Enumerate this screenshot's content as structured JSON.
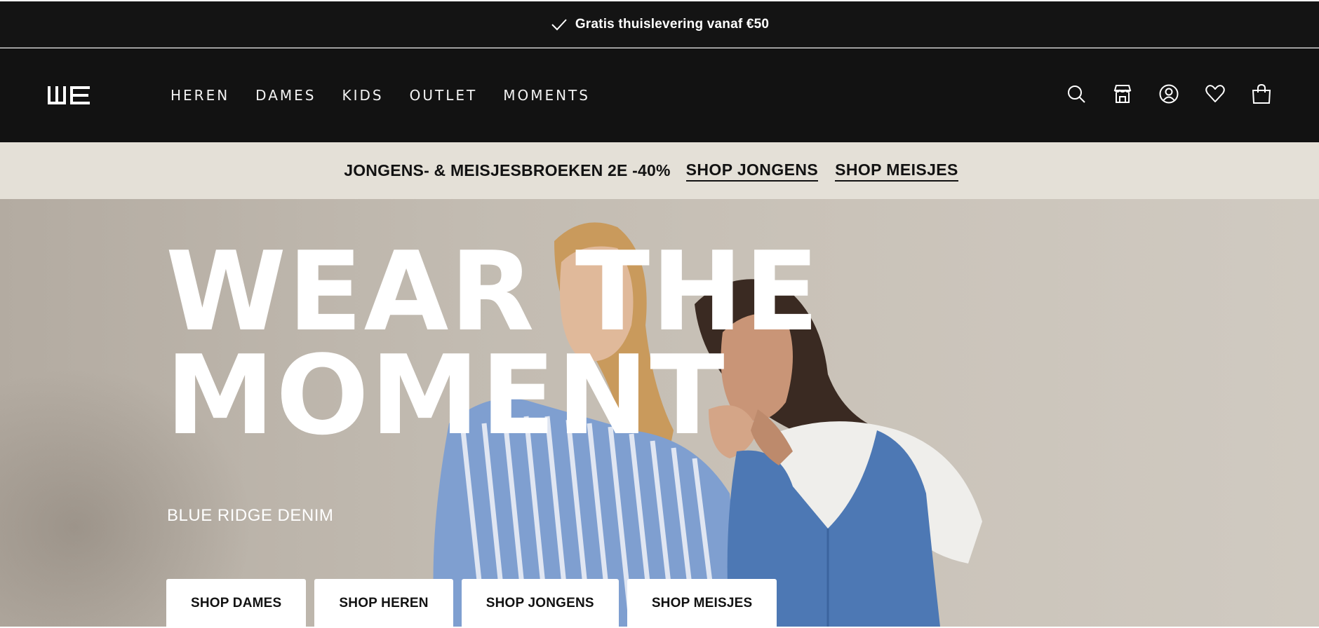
{
  "topbar": {
    "notice": "Gratis thuislevering vanaf €50",
    "icon": "checkmark-icon"
  },
  "header": {
    "logo_text": "WE",
    "nav": [
      {
        "label": "HEREN"
      },
      {
        "label": "DAMES"
      },
      {
        "label": "KIDS"
      },
      {
        "label": "OUTLET"
      },
      {
        "label": "MOMENTS"
      }
    ],
    "icons": [
      "search-icon",
      "store-icon",
      "account-icon",
      "wishlist-icon",
      "bag-icon"
    ]
  },
  "promo": {
    "text": "JONGENS- & MEISJESBROEKEN 2E -40%",
    "link_boys": "SHOP JONGENS",
    "link_girls": "SHOP MEISJES",
    "background": "#e4e0d7"
  },
  "hero": {
    "title_line1": "WEAR THE",
    "title_line2": "MOMENT",
    "subtitle": "BLUE RIDGE DENIM",
    "buttons": [
      {
        "label": "SHOP DAMES"
      },
      {
        "label": "SHOP HEREN"
      },
      {
        "label": "SHOP JONGENS"
      },
      {
        "label": "SHOP MEISJES"
      }
    ]
  },
  "colors": {
    "header_bg": "#121212",
    "accent_text": "#ffffff"
  }
}
